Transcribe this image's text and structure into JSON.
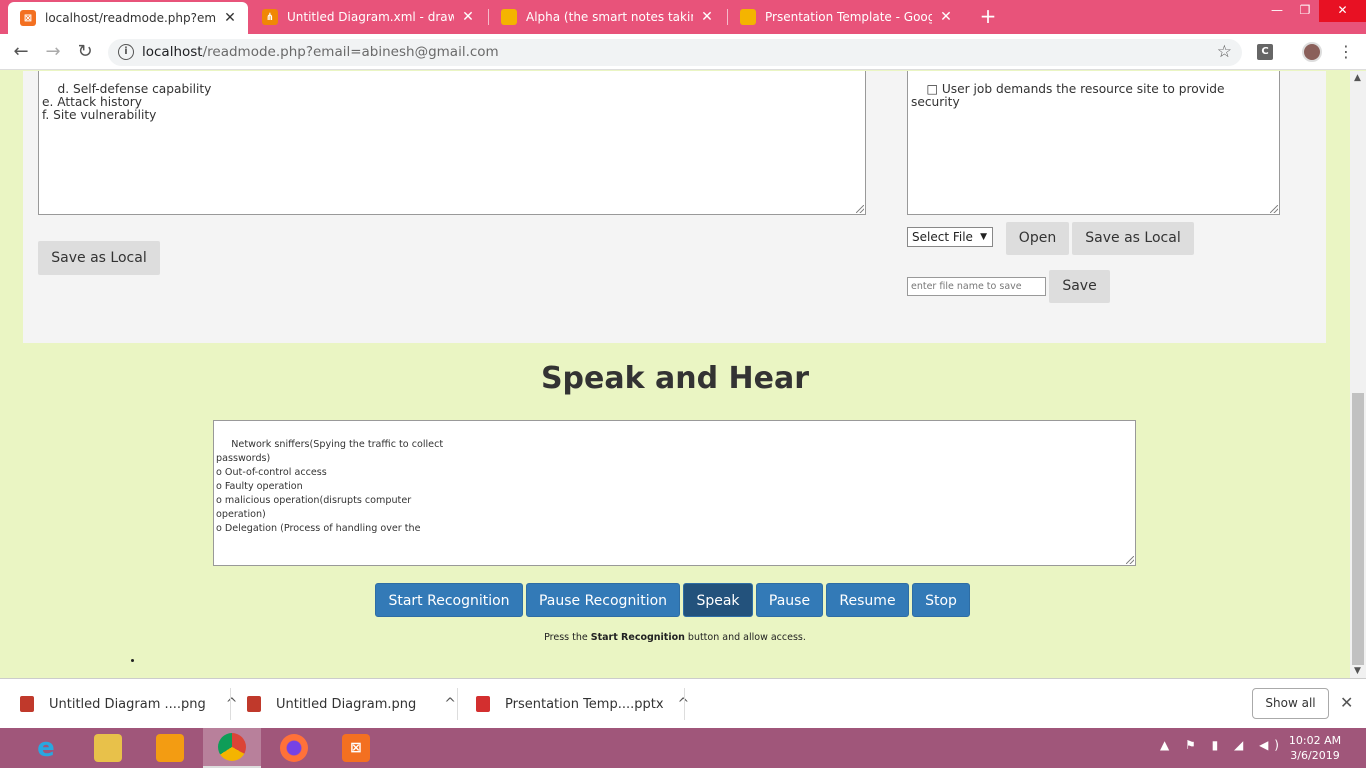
{
  "browser": {
    "tabs": [
      {
        "label": "localhost/readmode.php?email=a",
        "active": true,
        "icon": "xampp-icon",
        "color": "#f37021"
      },
      {
        "label": "Untitled Diagram.xml - draw.io",
        "active": false,
        "icon": "drawio-icon",
        "color": "#f08705"
      },
      {
        "label": "Alpha (the smart notes taking we",
        "active": false,
        "icon": "slides-icon",
        "color": "#f4b400"
      },
      {
        "label": "Prsentation Template - Google Sl",
        "active": false,
        "icon": "slides-icon",
        "color": "#f4b400"
      }
    ],
    "close_glyph": "✕",
    "new_tab_glyph": "+",
    "url_host": "localhost",
    "url_path": "/readmode.php?email=abinesh@gmail.com",
    "ext_letter": "C"
  },
  "editor": {
    "left_text": "d. Self-defense capability\ne. Attack history\nf. Site vulnerability",
    "right_text": "□ User job demands the resource site to provide security",
    "save_local_left": "Save as Local",
    "select_file": "Select File",
    "open": "Open",
    "save_local_right": "Save as Local",
    "filename_placeholder": "enter file name to save",
    "save": "Save"
  },
  "speak": {
    "heading": "Speak and Hear",
    "text": " Network sniffers(Spying the traffic to collect\npasswords)\no Out-of-control access\no Faulty operation\no malicious operation(disrupts computer\noperation)\no Delegation (Process of handling over the",
    "buttons": {
      "start": "Start Recognition",
      "pause_rec": "Pause Recognition",
      "speak": "Speak",
      "pause": "Pause",
      "resume": "Resume",
      "stop": "Stop"
    },
    "hint_prefix": "Press the ",
    "hint_bold": "Start Recognition",
    "hint_suffix": " button and allow access."
  },
  "downloads": {
    "items": [
      {
        "name": "Untitled Diagram ....png",
        "icon": "png-file-icon"
      },
      {
        "name": "Untitled Diagram.png",
        "icon": "png-file-icon"
      },
      {
        "name": "Prsentation Temp....pptx",
        "icon": "pptx-file-icon"
      }
    ],
    "show_all": "Show all"
  },
  "taskbar": {
    "apps": [
      "ie-icon",
      "file-explorer-icon",
      "uc-browser-icon",
      "chrome-icon",
      "firefox-icon",
      "xampp-icon"
    ],
    "time": "10:02 AM",
    "date": "3/6/2019"
  },
  "colors": {
    "titlebar": "#e8537a",
    "page_bg": "#eaf5c3",
    "panel_bg": "#f4f4f4",
    "primary_button": "#337ab7",
    "active_button": "#23527c",
    "taskbar": "#a0567a"
  }
}
